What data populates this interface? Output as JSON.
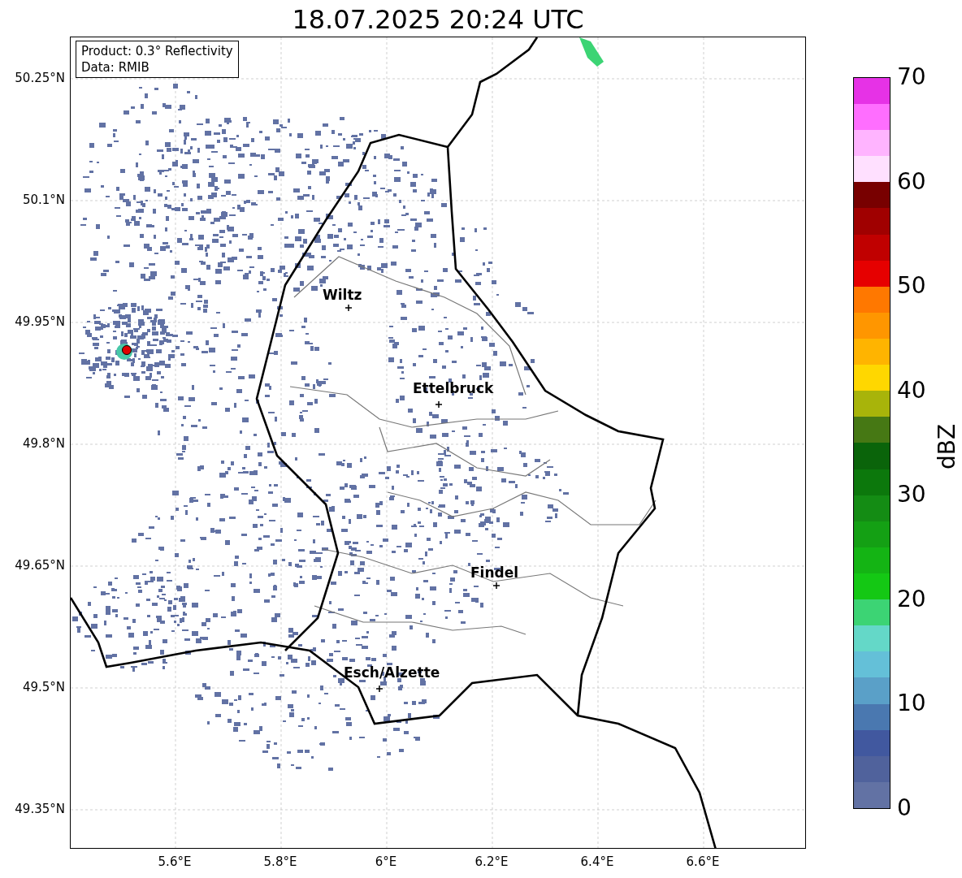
{
  "title": "18.07.2025 20:24 UTC",
  "info_box": [
    "Product: 0.3° Reflectivity",
    "Data: RMIB"
  ],
  "cities": [
    {
      "name": "Wiltz"
    },
    {
      "name": "Ettelbruck"
    },
    {
      "name": "Findel"
    },
    {
      "name": "Esch/Alzette"
    }
  ],
  "y_ticks": [
    "50.25°N",
    "50.1°N",
    "49.95°N",
    "49.8°N",
    "49.65°N",
    "49.5°N",
    "49.35°N"
  ],
  "x_ticks": [
    "5.6°E",
    "5.8°E",
    "6°E",
    "6.2°E",
    "6.4°E",
    "6.6°E"
  ],
  "colorbar": {
    "label": "dBZ",
    "ticks": [
      "70",
      "60",
      "50",
      "40",
      "30",
      "20",
      "10",
      "0"
    ]
  }
}
